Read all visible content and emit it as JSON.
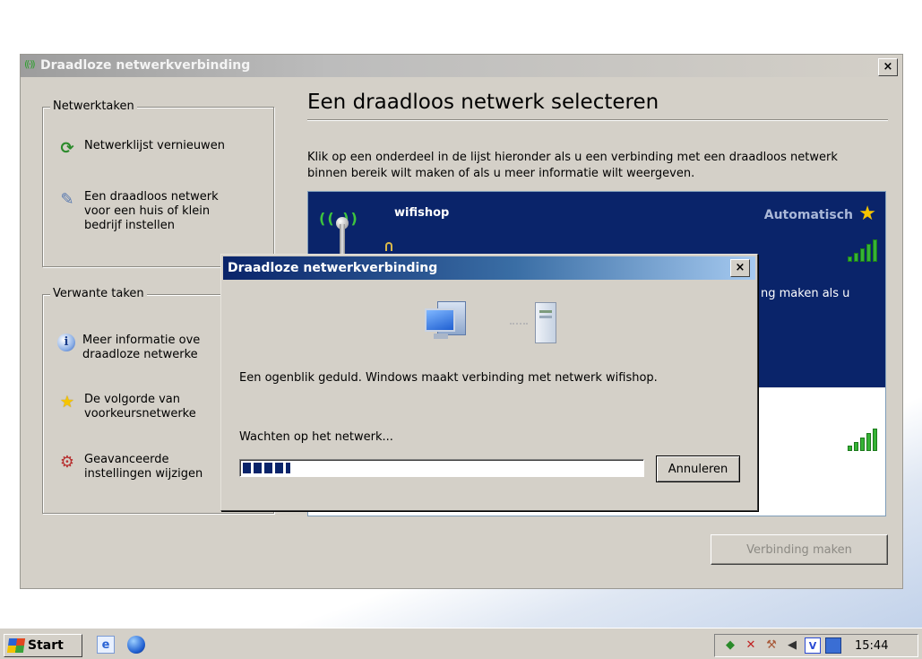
{
  "main_window": {
    "title": "Draadloze netwerkverbinding",
    "close_label": "×",
    "heading": "Een draadloos netwerk selecteren",
    "instructions": "Klik op een onderdeel in de lijst hieronder als u een verbinding met een draadloos netwerk binnen bereik wilt maken of als u meer informatie wilt weergeven.",
    "connect_button": "Verbinding maken"
  },
  "sidebar": {
    "network_tasks": {
      "legend": "Netwerktaken",
      "items": [
        {
          "label": "Netwerklijst vernieuwen",
          "icon": "refresh-icon"
        },
        {
          "label": "Een draadloos netwerk\nvoor een huis of klein\nbedrijf instellen",
          "icon": "wizard-icon"
        }
      ]
    },
    "related_tasks": {
      "legend": "Verwante taken",
      "items": [
        {
          "label": "Meer informatie ove\ndraadloze netwerke",
          "icon": "info-icon"
        },
        {
          "label": "De volgorde van\nvoorkeursnetwerke",
          "icon": "star-icon"
        },
        {
          "label": "Geavanceerde\ninstellingen wijzigen",
          "icon": "tools-icon"
        }
      ]
    }
  },
  "networks": [
    {
      "name": "wifishop",
      "status": "Automatisch",
      "description_fragment": "ng maken als u",
      "selected": true
    }
  ],
  "dialog": {
    "title": "Draadloze netwerkverbinding",
    "close_label": "×",
    "message": "Een ogenblik geduld. Windows maakt verbinding met netwerk wifishop.",
    "waiting": "Wachten op het netwerk...",
    "cancel_button": "Annuleren",
    "progress": 0.12
  },
  "taskbar": {
    "start_label": "Start",
    "clock": "15:44",
    "quick_launch": [
      "ie-icon",
      "globe-icon"
    ],
    "tray_icons": [
      "network-icon",
      "lan-disconnected-icon",
      "tools-icon",
      "volume-icon",
      "antivirus-icon",
      "monitor-icon"
    ]
  },
  "colors": {
    "selection_blue": "#0a246a",
    "dialog_title_start": "#0a246a",
    "dialog_title_end": "#a6caf0",
    "window_face": "#d4d0c8",
    "signal_green": "#35b335"
  }
}
